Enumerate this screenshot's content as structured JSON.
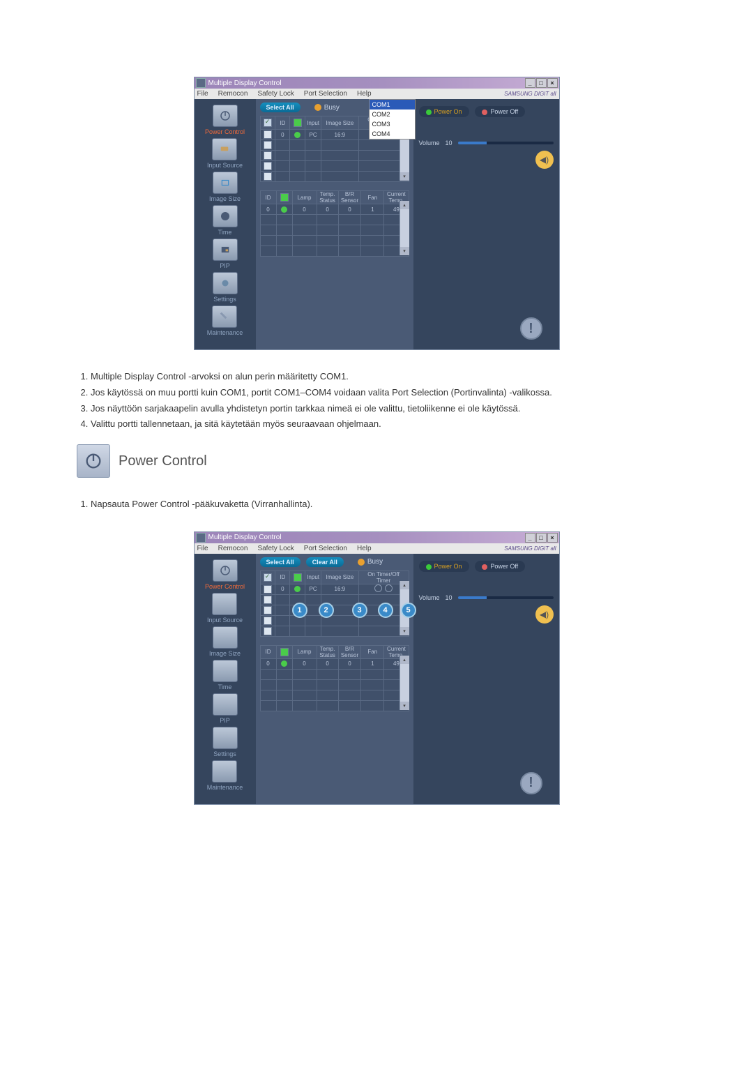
{
  "screenshots": {
    "windowTitle": "Multiple Display Control",
    "menu": {
      "file": "File",
      "remocon": "Remocon",
      "safetyLock": "Safety Lock",
      "portSelection": "Port Selection",
      "help": "Help"
    },
    "brand": "SAMSUNG DIGIT all",
    "dropdown": {
      "com1": "COM1",
      "com2": "COM2",
      "com3": "COM3",
      "com4": "COM4"
    },
    "sidebar": {
      "powerControl": "Power Control",
      "inputSource": "Input Source",
      "imageSize": "Image Size",
      "time": "Time",
      "pip": "PIP",
      "settings": "Settings",
      "maintenance": "Maintenance"
    },
    "buttons": {
      "selectAll": "Select All",
      "clearAll": "Clear All",
      "busy": "Busy"
    },
    "table1": {
      "cols": {
        "check": "☑",
        "id": "ID",
        "status": "",
        "input": "Input",
        "imageSize": "Image Size",
        "timer": "On Timer/Off Timer"
      },
      "row": {
        "id": "0",
        "input": "PC",
        "imageSize": "16:9"
      }
    },
    "table2": {
      "cols": {
        "id": "ID",
        "status": "",
        "lamp": "Lamp",
        "temp": "Temp. Status",
        "sensor": "B/R Sensor",
        "fan": "Fan",
        "currentTemp": "Current Temp."
      },
      "row": {
        "id": "0",
        "lamp": "0",
        "temp": "0",
        "sensor": "0",
        "fan": "1",
        "currentTemp": "49"
      }
    },
    "right": {
      "powerOn": "Power On",
      "powerOff": "Power Off",
      "volume": "Volume",
      "volVal": "10"
    }
  },
  "instr1": {
    "i1": "Multiple Display Control -arvoksi on alun perin määritetty COM1.",
    "i2": "Jos käytössä on muu portti kuin COM1, portit COM1–COM4 voidaan valita Port Selection (Portinvalinta) -valikossa.",
    "i3": "Jos näyttöön sarjakaapelin avulla yhdistetyn portin tarkkaa nimeä ei ole valittu, tietoliikenne ei ole käytössä.",
    "i4": "Valittu portti tallennetaan, ja sitä käytetään myös seuraavaan ohjelmaan."
  },
  "sectionTitle": "Power Control",
  "instr2": {
    "i1": "Napsauta Power Control -pääkuvaketta (Virranhallinta)."
  },
  "numbers": {
    "n1": "1",
    "n2": "2",
    "n3": "3",
    "n4": "4",
    "n5": "5"
  }
}
